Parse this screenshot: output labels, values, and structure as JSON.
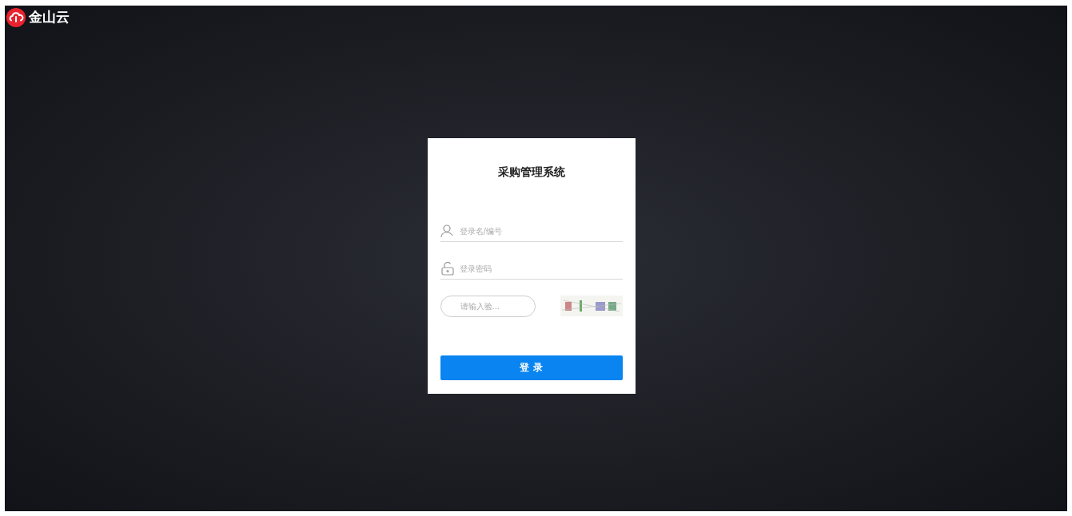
{
  "logo": {
    "text": "金山云"
  },
  "login": {
    "title": "采购管理系统",
    "username": {
      "placeholder": "登录名/编号"
    },
    "password": {
      "placeholder": "登录密码"
    },
    "captcha": {
      "placeholder": "请输入验..."
    },
    "submit": "登 录"
  }
}
